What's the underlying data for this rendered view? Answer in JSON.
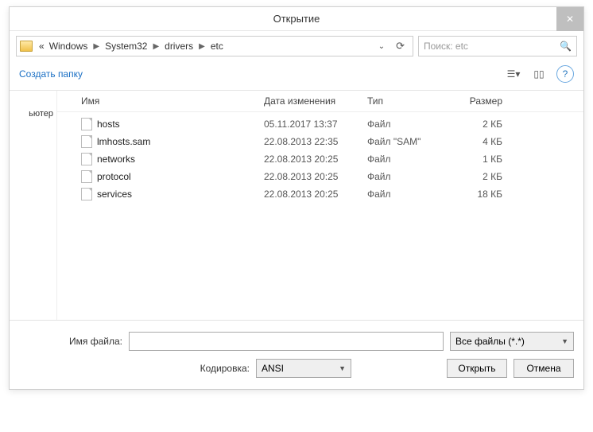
{
  "title": "Открытие",
  "breadcrumbs": [
    "Windows",
    "System32",
    "drivers",
    "etc"
  ],
  "search": {
    "placeholder": "Поиск: etc"
  },
  "toolbar": {
    "new_folder": "Создать папку"
  },
  "sidebar": {
    "computer": "ьютер"
  },
  "columns": {
    "name": "Имя",
    "date": "Дата изменения",
    "type": "Тип",
    "size": "Размер"
  },
  "files": [
    {
      "name": "hosts",
      "date": "05.11.2017 13:37",
      "type": "Файл",
      "size": "2 КБ"
    },
    {
      "name": "lmhosts.sam",
      "date": "22.08.2013 22:35",
      "type": "Файл \"SAM\"",
      "size": "4 КБ"
    },
    {
      "name": "networks",
      "date": "22.08.2013 20:25",
      "type": "Файл",
      "size": "1 КБ"
    },
    {
      "name": "protocol",
      "date": "22.08.2013 20:25",
      "type": "Файл",
      "size": "2 КБ"
    },
    {
      "name": "services",
      "date": "22.08.2013 20:25",
      "type": "Файл",
      "size": "18 КБ"
    }
  ],
  "bottom": {
    "filename_label": "Имя файла:",
    "filename_value": "",
    "encoding_label": "Кодировка:",
    "encoding_value": "ANSI",
    "filter_value": "Все файлы  (*.*)",
    "open": "Открыть",
    "cancel": "Отмена"
  }
}
